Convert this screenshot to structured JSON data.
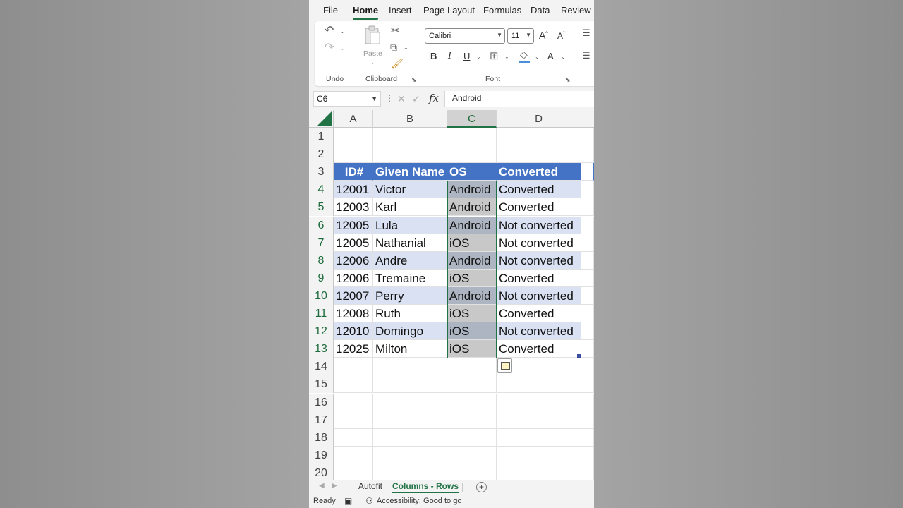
{
  "menu": {
    "tabs": [
      "File",
      "Home",
      "Insert",
      "Page Layout",
      "Formulas",
      "Data",
      "Review"
    ],
    "active": "Home"
  },
  "ribbon": {
    "groups": {
      "undo": "Undo",
      "clipboard": "Clipboard",
      "font": "Font"
    },
    "paste_label": "Paste",
    "font_name": "Calibri",
    "font_size": "11",
    "bold": "B",
    "italic": "I",
    "underline": "U",
    "font_color_glyph": "A"
  },
  "formula_bar": {
    "name_box": "C6",
    "fx": "fx",
    "value": "Android"
  },
  "grid": {
    "columns": [
      "A",
      "B",
      "C",
      "D"
    ],
    "selected_column": "C",
    "rows": [
      "1",
      "2",
      "3",
      "4",
      "5",
      "6",
      "7",
      "8",
      "9",
      "10",
      "11",
      "12",
      "13",
      "14",
      "15",
      "16",
      "17",
      "18",
      "19",
      "20"
    ],
    "table": {
      "headers": [
        "ID#",
        "Given Name",
        "OS",
        "Converted"
      ],
      "data": [
        [
          "12001",
          "Victor",
          "Android",
          "Converted"
        ],
        [
          "12003",
          "Karl",
          "Android",
          "Converted"
        ],
        [
          "12005",
          "Lula",
          "Android",
          "Not converted"
        ],
        [
          "12005",
          "Nathanial",
          "iOS",
          "Not converted"
        ],
        [
          "12006",
          "Andre",
          "Android",
          "Not converted"
        ],
        [
          "12006",
          "Tremaine",
          "iOS",
          "Converted"
        ],
        [
          "12007",
          "Perry",
          "Android",
          "Not converted"
        ],
        [
          "12008",
          "Ruth",
          "iOS",
          "Converted"
        ],
        [
          "12010",
          "Domingo",
          "iOS",
          "Not converted"
        ],
        [
          "12025",
          "Milton",
          "iOS",
          "Converted"
        ]
      ]
    }
  },
  "sheets": {
    "tabs": [
      "Autofit",
      "Columns - Rows"
    ],
    "active": "Columns - Rows"
  },
  "status": {
    "ready": "Ready",
    "accessibility": "Accessibility: Good to go"
  },
  "colors": {
    "accent": "#217346",
    "table_header": "#4472c4",
    "table_band": "#d9e1f2",
    "selection": "#c8c8c8"
  }
}
